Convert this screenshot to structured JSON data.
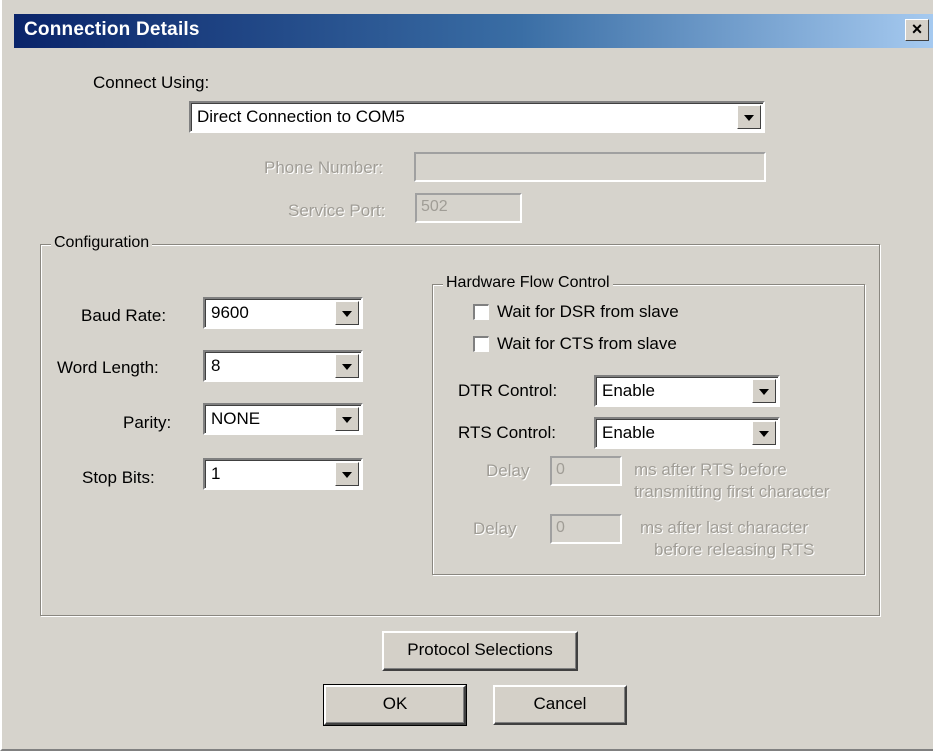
{
  "window": {
    "title": "Connection Details",
    "close_glyph": "×"
  },
  "connect_using": {
    "label": "Connect Using:",
    "value": "Direct Connection to COM5"
  },
  "phone_number": {
    "label": "Phone Number:",
    "value": ""
  },
  "service_port": {
    "label": "Service Port:",
    "value": "502"
  },
  "configuration": {
    "title": "Configuration",
    "baud_rate": {
      "label": "Baud Rate:",
      "value": "9600"
    },
    "word_length": {
      "label": "Word Length:",
      "value": "8"
    },
    "parity": {
      "label": "Parity:",
      "value": "NONE"
    },
    "stop_bits": {
      "label": "Stop Bits:",
      "value": "1"
    }
  },
  "hardware_flow": {
    "title": "Hardware Flow Control",
    "wait_dsr": {
      "label": "Wait for DSR from slave",
      "checked": false
    },
    "wait_cts": {
      "label": "Wait for CTS from slave",
      "checked": false
    },
    "dtr_control": {
      "label": "DTR Control:",
      "value": "Enable"
    },
    "rts_control": {
      "label": "RTS Control:",
      "value": "Enable"
    },
    "delay1": {
      "label": "Delay",
      "value": "0",
      "note_line1": "ms after RTS before",
      "note_line2": "transmitting first character"
    },
    "delay2": {
      "label": "Delay",
      "value": "0",
      "note_line1": "ms after last character",
      "note_line2": "before releasing RTS"
    }
  },
  "buttons": {
    "protocol_selections": "Protocol Selections",
    "ok": "OK",
    "cancel": "Cancel"
  }
}
